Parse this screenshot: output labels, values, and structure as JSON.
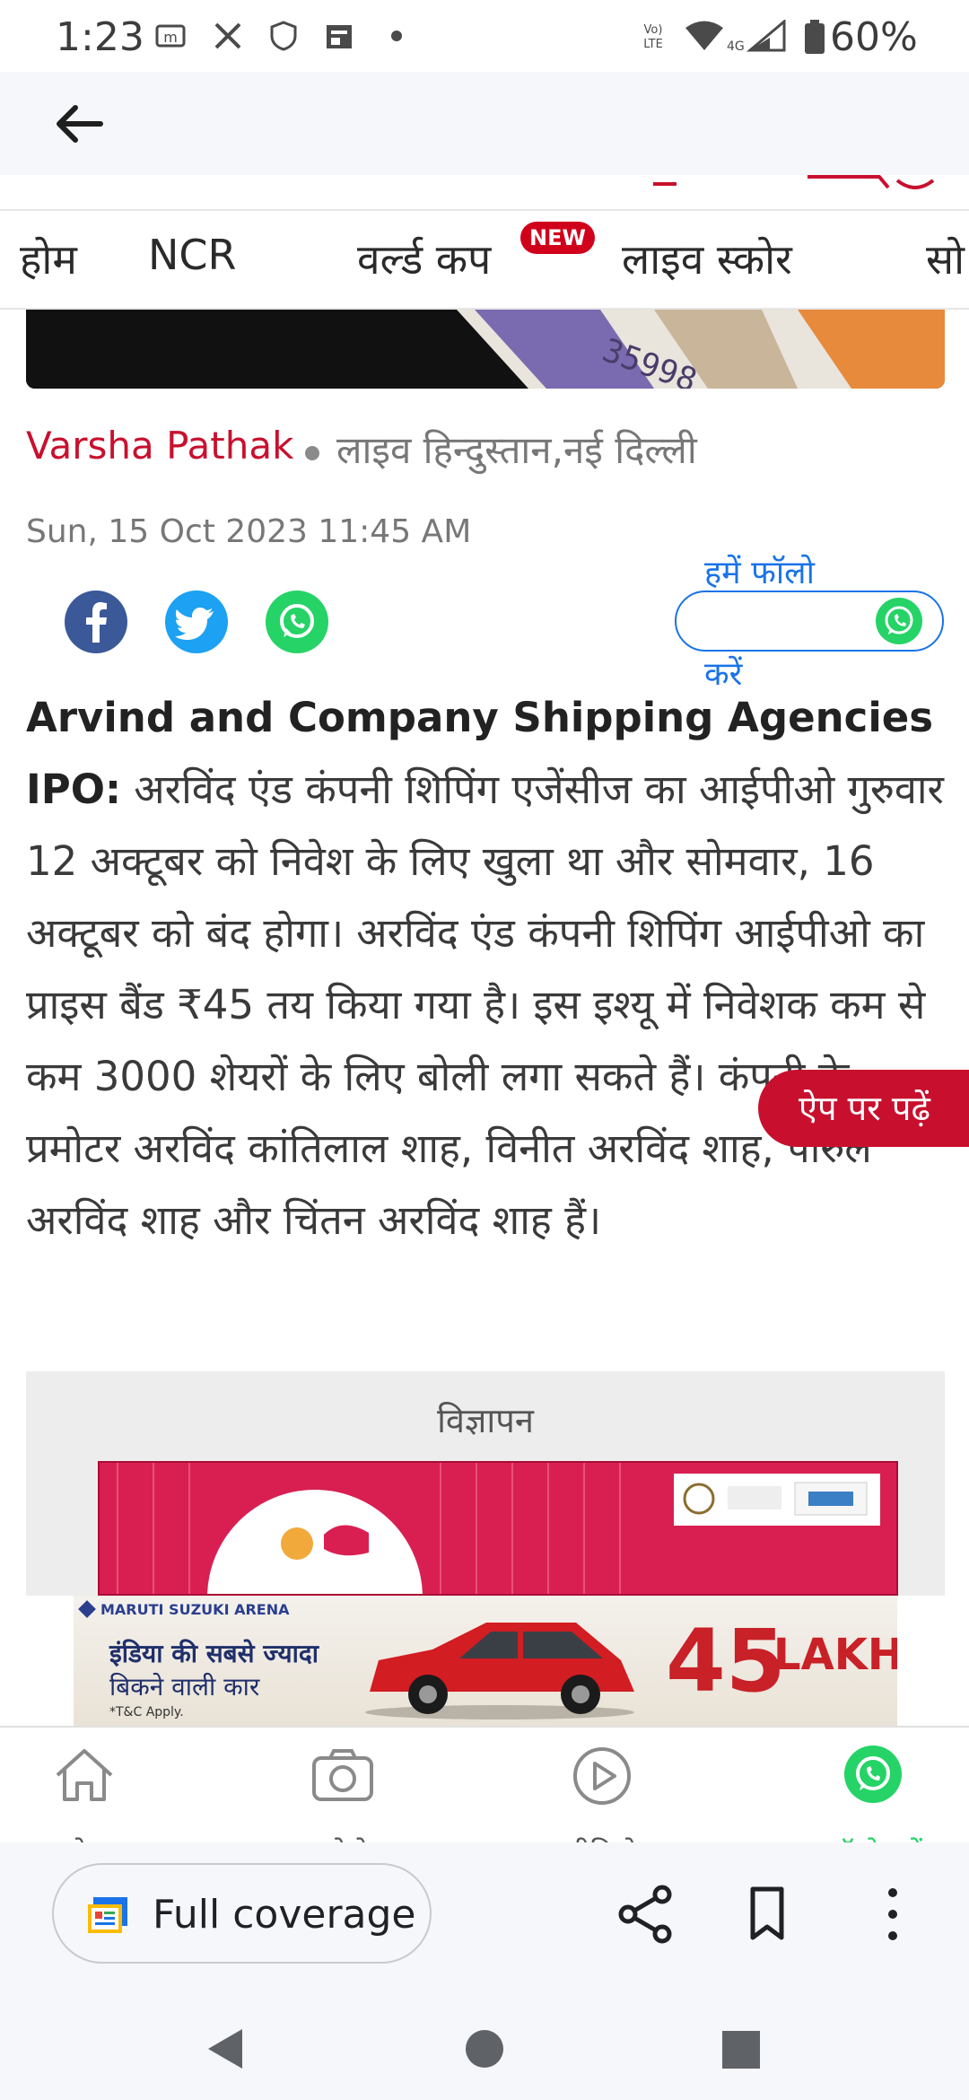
{
  "status_bar": {
    "time": "1:23",
    "battery": "60%"
  },
  "app_bar": {
    "back_label": "back"
  },
  "nav_tabs": [
    "होम",
    "NCR",
    "वर्ल्ड कप",
    "लाइव स्कोर",
    "सो"
  ],
  "nav_new_badge": "NEW",
  "article": {
    "author": "Varsha Pathak",
    "publisher": "लाइव हिन्दुस्तान,नई दिल्ली",
    "date": "Sun, 15 Oct 2023 11:45 AM",
    "lead": "Arvind and Company Shipping Agencies IPO:",
    "body": " अरविंद एंड कंपनी शिपिंग एजेंसीज का आईपीओ गुरुवार 12 अक्टूबर को निवेश के लिए खुला था और सोमवार, 16 अक्टूबर को बंद होगा। अरविंद एंड कंपनी शिपिंग आईपीओ का प्राइस बैंड ₹45 तय किया गया है। इस इश्यू में निवेशक कम से कम 3000 शेयरों के लिए बोली लगा सकते हैं। कंपनी के प्रमोटर अरविंद कांतिलाल शाह, विनीत अरविंद शाह, पारुल अरविंद शाह और चिंतन अरविंद शाह हैं।"
  },
  "follow": {
    "label_top": "हमें फॉलो",
    "label_bottom": "करें"
  },
  "app_pill": "ऐप पर पढ़ें",
  "ad": {
    "label": "विज्ञापन"
  },
  "banner": {
    "brand": "MARUTI SUZUKI ARENA",
    "line1": "इंडिया की सबसे ज्यादा",
    "line2": "बिकने वाली कार",
    "tnc": "*T&C Apply.",
    "number": "45",
    "unit": "LAKH"
  },
  "site_nav": [
    {
      "label": "होम",
      "icon": "home-icon"
    },
    {
      "label": "फोटो",
      "icon": "camera-icon"
    },
    {
      "label": "वीडियो",
      "icon": "play-icon"
    },
    {
      "label": "फॉलो करें",
      "icon": "whatsapp-icon"
    }
  ],
  "chrome_bar": {
    "full_coverage": "Full coverage"
  },
  "colors": {
    "brand_red": "#c8102e",
    "link_blue": "#1a73e8",
    "whatsapp_green": "#25d366"
  }
}
